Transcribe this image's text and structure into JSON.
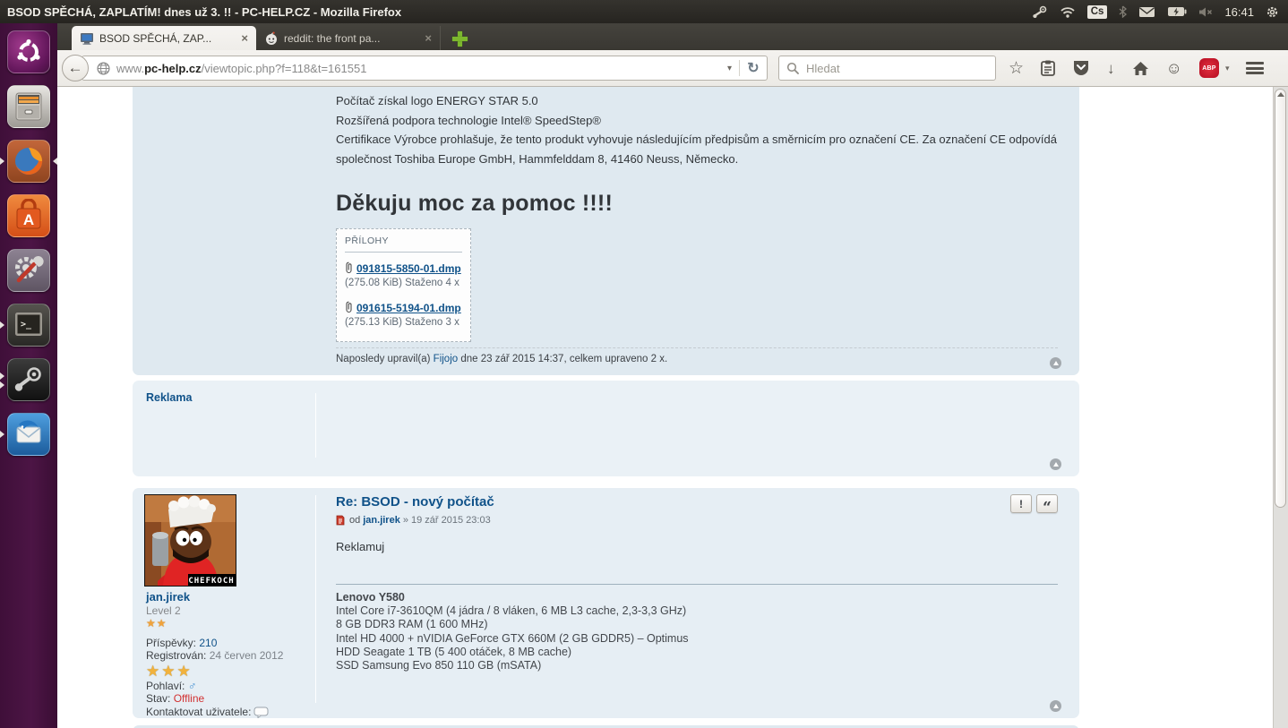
{
  "desktop": {
    "window_title": "BSOD SPĚCHÁ, ZAPLATÍM! dnes už 3. !! - PC-HELP.CZ - Mozilla Firefox",
    "tray": {
      "keyboard_layout": "Cs",
      "time": "16:41"
    },
    "launcher_items": [
      "ubuntu-dash",
      "files",
      "firefox",
      "software-center",
      "system-settings",
      "terminal",
      "steam",
      "thunderbird"
    ]
  },
  "browser": {
    "tabs": [
      {
        "label": "BSOD SPĚCHÁ, ZAP..."
      },
      {
        "label": "reddit: the front pa..."
      }
    ],
    "tab_close": "×",
    "urlbar": {
      "www": "www.",
      "domain": "pc-help.cz",
      "path": "/viewtopic.php?f=118&t=161551",
      "caret": "▾",
      "reload": "↻"
    },
    "search": {
      "placeholder": "Hledat"
    },
    "adblock_label": "ABP",
    "back_glyph": "←"
  },
  "forum": {
    "post1": {
      "lines": [
        "Počítač získal logo ENERGY STAR 5.0",
        "Rozšířená podpora technologie Intel® SpeedStep®",
        "Certifikace Výrobce prohlašuje, že tento produkt vyhovuje následujícím předpisům a směrnicím pro označení CE. Za označení CE odpovídá společnost Toshiba Europe GmbH, Hammfelddam 8, 41460 Neuss, Německo."
      ],
      "heading": "Děkuju moc za pomoc !!!!",
      "attachments": {
        "title": "PŘÍLOHY",
        "items": [
          {
            "name": "091815-5850-01.dmp",
            "meta": "(275.08 KiB) Staženo 4 x"
          },
          {
            "name": "091615-5194-01.dmp",
            "meta": "(275.13 KiB) Staženo 3 x"
          }
        ]
      },
      "edit_note": {
        "pre": "Naposledy upravil(a) ",
        "user": "Fijojo",
        "rest": " dne 23 zář 2015 14:37, celkem upraveno 2 x."
      }
    },
    "ad": {
      "label": "Reklama"
    },
    "post2": {
      "title": "Re: BSOD - nový počítač",
      "byline": {
        "pre": "od",
        "user": "jan.jirek",
        "rest": "» 19 zář 2015 23:03"
      },
      "report_label": "!",
      "quote_label": "“",
      "body": "Reklamuj",
      "signature": {
        "title": "Lenovo Y580",
        "lines": [
          "Intel Core i7-3610QM (4 jádra / 8 vláken, 6 MB L3 cache, 2,3-3,3 GHz)",
          "8 GB DDR3 RAM (1 600 MHz)",
          "Intel HD 4000 + nVIDIA GeForce GTX 660M (2 GB GDDR5) – Optimus",
          "HDD Seagate 1 TB (5 400 otáček, 8 MB cache)",
          "SSD Samsung Evo 850 110 GB (mSATA)"
        ]
      },
      "profile": {
        "username": "jan.jirek",
        "rank": "Level 2",
        "rank_stars": "★★",
        "posts_label": "Příspěvky:",
        "posts_value": "210",
        "reg_label": "Registrován:",
        "reg_value": "24 červen 2012",
        "karma_stars": "★★★",
        "gender_label": "Pohlaví:",
        "gender_symbol": "♂",
        "status_label": "Stav:",
        "status_value": "Offline",
        "contact_label": "Kontaktovat uživatele:",
        "avatar_caption": "CHEFKOCH"
      }
    }
  }
}
